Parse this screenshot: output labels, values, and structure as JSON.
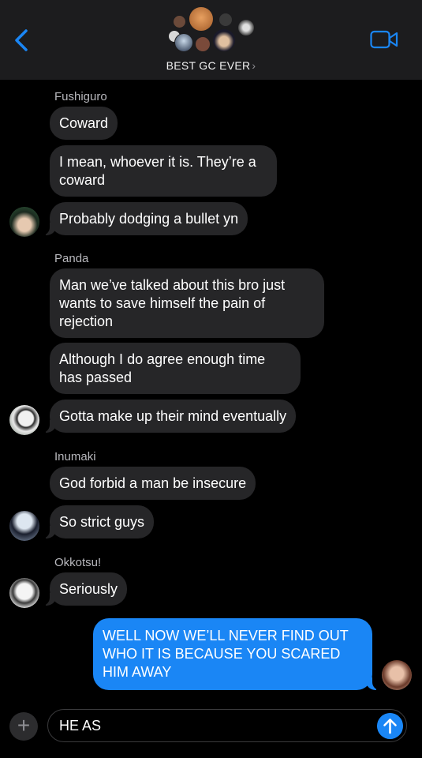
{
  "header": {
    "group_name": "BEST GC EVER",
    "chevron": "›",
    "back_icon": "chevron-left-icon",
    "video_icon": "video-camera-icon",
    "accent": "#1a86f5"
  },
  "conversation": [
    {
      "sender": "Fushiguro",
      "messages": [
        "Coward",
        "I mean, whoever it is. They’re a coward",
        "Probably dodging a bullet yn"
      ]
    },
    {
      "sender": "Panda",
      "messages": [
        "Man we’ve talked about this bro just wants to save himself the pain of rejection",
        "Although I do agree enough time has passed",
        "Gotta make up their mind eventually"
      ]
    },
    {
      "sender": "Inumaki",
      "messages": [
        "God forbid a man be insecure",
        "So strict guys"
      ]
    },
    {
      "sender": "Okkotsu!",
      "messages": [
        "Seriously"
      ]
    }
  ],
  "outgoing": {
    "text": "WELL NOW WE’LL NEVER FIND OUT WHO IT IS BECAUSE YOU SCARED HIM AWAY"
  },
  "composer": {
    "value": "HE AS",
    "plus": "+",
    "send_icon": "arrow-up-icon"
  },
  "colors": {
    "incoming_bubble": "#262628",
    "outgoing_bubble": "#1a86f5",
    "header_bg": "#1c1c1e"
  }
}
